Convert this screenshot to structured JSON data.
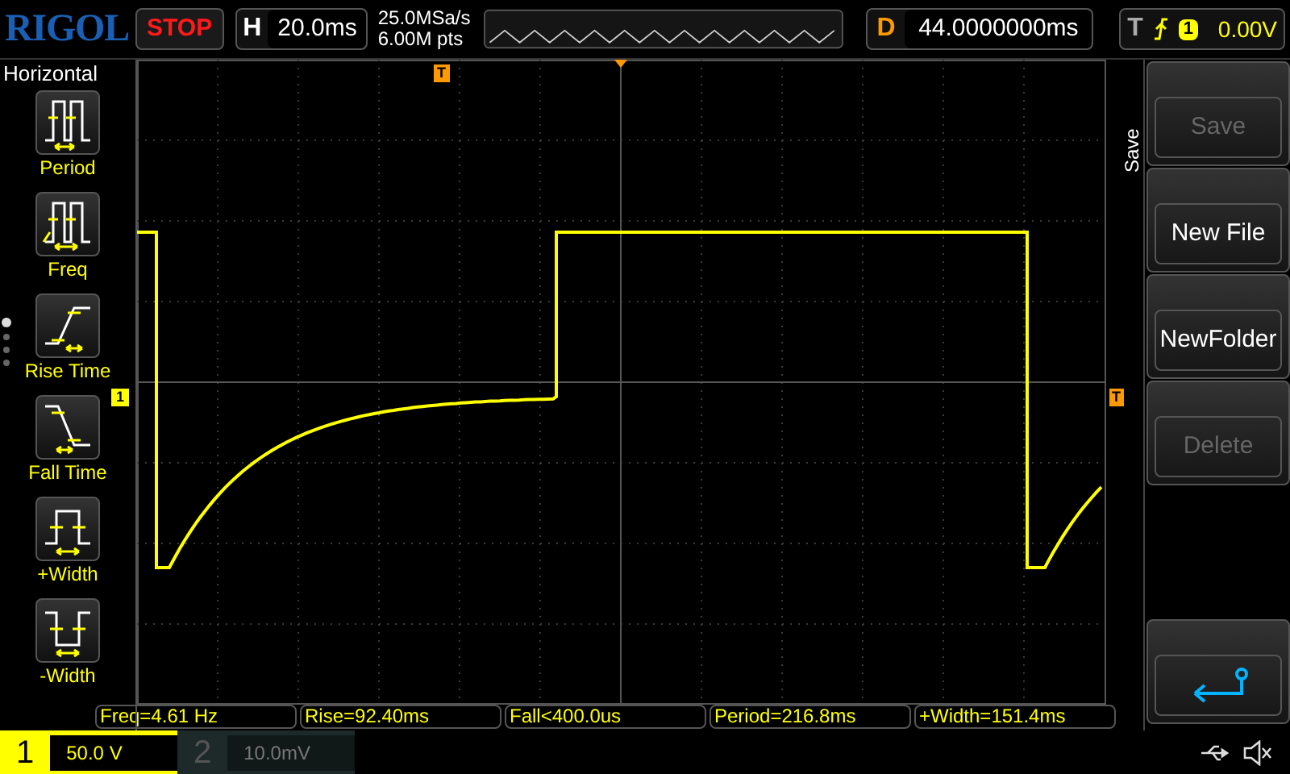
{
  "header": {
    "logo": "RIGOL",
    "run_state": "STOP",
    "timebase_label": "H",
    "timebase": "20.0ms",
    "sample_rate": "25.0MSa/s",
    "memory_depth": "6.00M pts",
    "delay_label": "D",
    "delay": "44.0000000ms",
    "trigger_label": "T",
    "trigger_source": "1",
    "trigger_level": "0.00V"
  },
  "left_menu": {
    "title": "Horizontal",
    "items": [
      {
        "kind": "period",
        "label": "Period"
      },
      {
        "kind": "freq",
        "label": "Freq"
      },
      {
        "kind": "rise",
        "label": "Rise Time"
      },
      {
        "kind": "fall",
        "label": "Fall Time"
      },
      {
        "kind": "pwidth",
        "label": "+Width"
      },
      {
        "kind": "nwidth",
        "label": "-Width"
      }
    ],
    "pages": [
      {
        "selected": true
      },
      {
        "selected": false
      },
      {
        "selected": false
      },
      {
        "selected": false
      }
    ]
  },
  "grid": {
    "trigger_position_marker": "T",
    "channel_marker": "1",
    "trigger_level_marker": "T"
  },
  "right_menu": {
    "title": "Save",
    "items": [
      {
        "kind": "text",
        "label": "Save",
        "disabled": true
      },
      {
        "kind": "text",
        "label": "New File",
        "disabled": false
      },
      {
        "kind": "text",
        "label": "NewFolder",
        "disabled": false
      },
      {
        "kind": "text",
        "label": "Delete",
        "disabled": true
      },
      {
        "kind": "back",
        "disabled": false
      }
    ]
  },
  "measurements": [
    "Freq=4.61 Hz",
    "Rise=92.40ms",
    "Fall<400.0us",
    "Period=216.8ms",
    "+Width=151.4ms"
  ],
  "channels": [
    {
      "number": "1",
      "scale": "50.0 V",
      "selected": true
    },
    {
      "number": "2",
      "scale": "10.0mV",
      "selected": false
    }
  ]
}
